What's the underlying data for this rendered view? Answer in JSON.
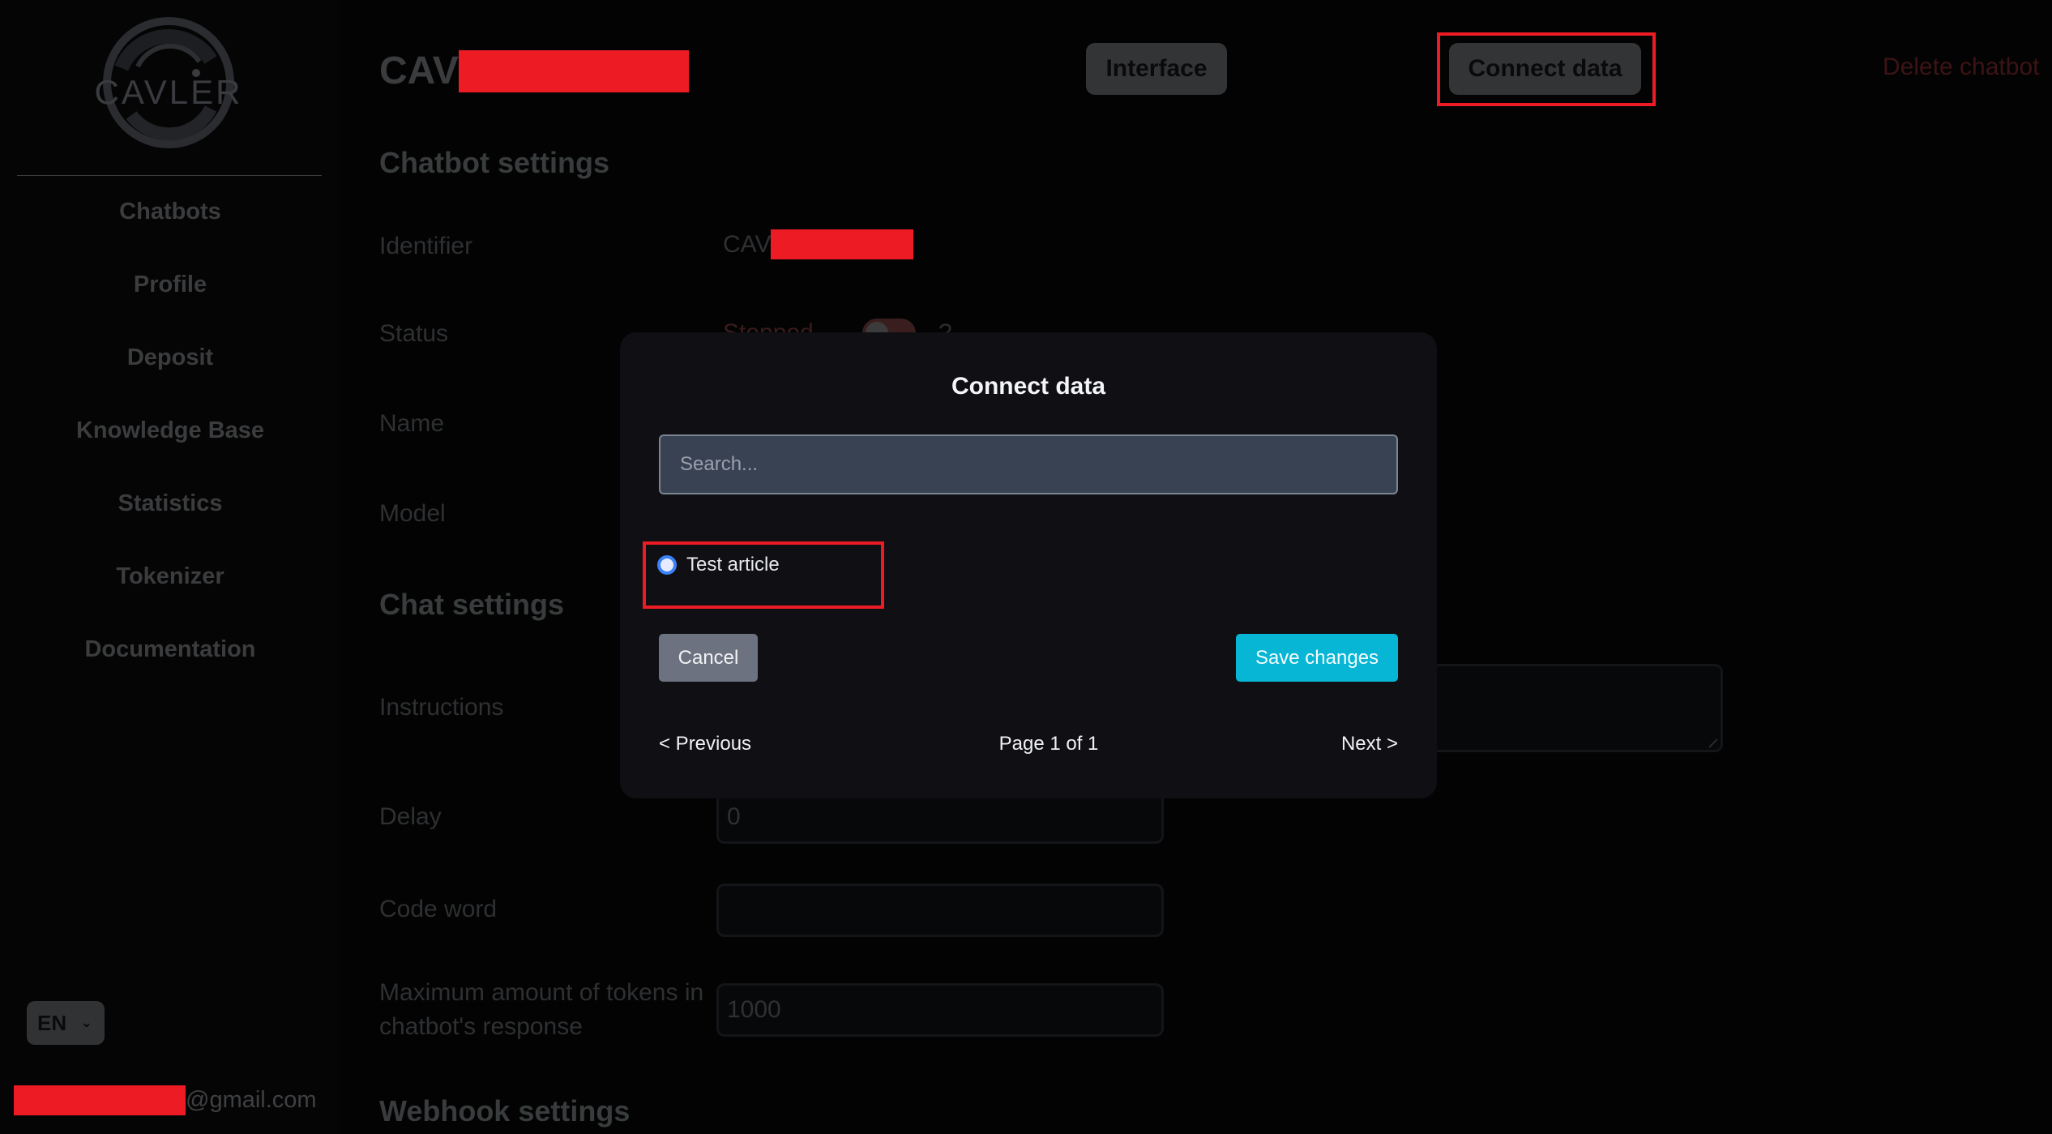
{
  "brand": {
    "logo_text": "CAVLER"
  },
  "sidebar": {
    "items": [
      {
        "label": "Chatbots"
      },
      {
        "label": "Profile"
      },
      {
        "label": "Deposit"
      },
      {
        "label": "Knowledge Base"
      },
      {
        "label": "Statistics"
      },
      {
        "label": "Tokenizer"
      },
      {
        "label": "Documentation"
      }
    ],
    "language": "EN",
    "user_email_suffix": "@gmail.com"
  },
  "header": {
    "title_prefix": "CAV",
    "interface_label": "Interface",
    "connect_data_label": "Connect data",
    "delete_label": "Delete chatbot"
  },
  "chatbot_settings": {
    "heading": "Chatbot settings",
    "identifier_label": "Identifier",
    "identifier_prefix": "CAV",
    "status_label": "Status",
    "status_value": "Stopped",
    "status_enabled": false,
    "help_glyph": "?",
    "name_label": "Name",
    "model_label": "Model"
  },
  "chat_settings": {
    "heading": "Chat settings",
    "instructions_label": "Instructions",
    "instructions_value": "",
    "delay_label": "Delay",
    "delay_value": "0",
    "code_word_label": "Code word",
    "code_word_value": "",
    "max_tokens_label": "Maximum amount of tokens in chatbot's response",
    "max_tokens_value": "1000"
  },
  "webhook_settings": {
    "heading": "Webhook settings"
  },
  "modal": {
    "title": "Connect data",
    "search_placeholder": "Search...",
    "search_value": "",
    "items": [
      {
        "label": "Test article",
        "selected": false
      }
    ],
    "cancel_label": "Cancel",
    "save_label": "Save changes",
    "prev_label": "< Previous",
    "page_text": "Page 1 of 1",
    "next_label": "Next >",
    "accent_color": "#06b6d4"
  }
}
